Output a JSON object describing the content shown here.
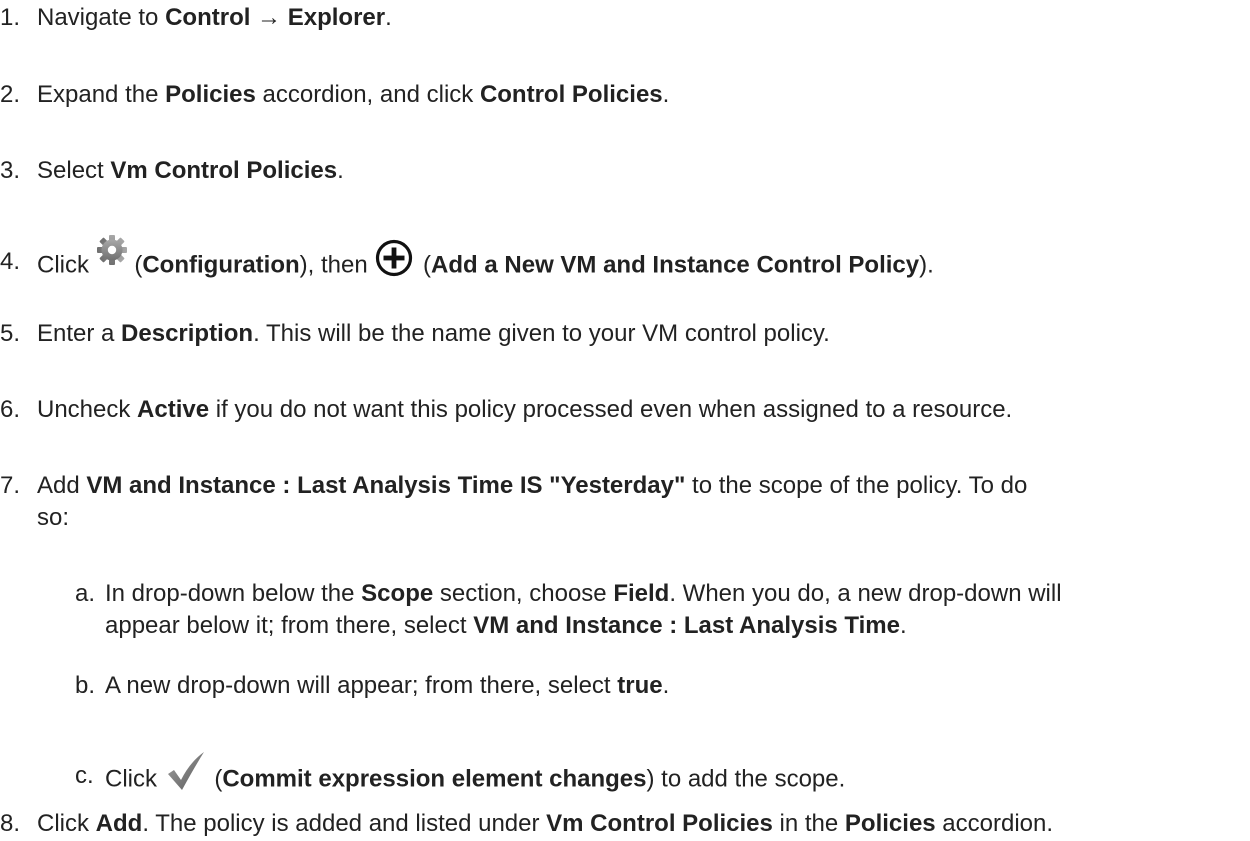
{
  "steps": [
    {
      "num": "1.",
      "p1": "Navigate to ",
      "b1": "Control",
      "p2": " → ",
      "b2": "Explorer",
      "p3": "."
    },
    {
      "num": "2.",
      "p1": "Expand the ",
      "b1": "Policies",
      "p2": " accordion, and click ",
      "b2": "Control Policies",
      "p3": "."
    },
    {
      "num": "3.",
      "p1": "Select ",
      "b1": "Vm Control Policies",
      "p2": "."
    },
    {
      "num": "4.",
      "p1": "Click ",
      "p2": " (",
      "b1": "Configuration",
      "p3": "), then ",
      "p4": " (",
      "b2": "Add a New VM and Instance Control Policy",
      "p5": ")."
    },
    {
      "num": "5.",
      "p1": "Enter a ",
      "b1": "Description",
      "p2": ". This will be the name given to your VM control policy."
    },
    {
      "num": "6.",
      "p1": "Uncheck ",
      "b1": "Active",
      "p2": " if you do not want this policy processed even when assigned to a resource."
    },
    {
      "num": "7.",
      "p1": "Add ",
      "b1": "VM and Instance : Last Analysis Time IS \"Yesterday\"",
      "p2": " to the scope of the policy. To do",
      "p3": "so:"
    },
    {
      "num": "8.",
      "p1": "Click ",
      "b1": "Add",
      "p2": ". The policy is added and listed under ",
      "b2": "Vm Control Policies",
      "p3": " in the ",
      "b3": "Policies",
      "p4": " accordion."
    }
  ],
  "substeps": [
    {
      "letter": "a.",
      "p1": "In drop-down below the ",
      "b1": "Scope",
      "p2": " section, choose ",
      "b2": "Field",
      "p3": ". When you do, a new drop-down will",
      "p4": "appear below it; from there, select ",
      "b3": "VM and Instance : Last Analysis Time",
      "p5": "."
    },
    {
      "letter": "b.",
      "p1": "A new drop-down will appear; from there, select ",
      "b1": "true",
      "p2": "."
    },
    {
      "letter": "c.",
      "p1": "Click ",
      "p2": " (",
      "b1": "Commit expression element changes",
      "p3": ") to add the scope."
    }
  ],
  "icons": {
    "gear": "gear-icon",
    "add": "add-circle-icon",
    "check": "checkmark-icon"
  },
  "colors": {
    "text": "#222222",
    "gear": "#8f8f8f",
    "check": "#6e6e6e",
    "add": "#111111"
  }
}
